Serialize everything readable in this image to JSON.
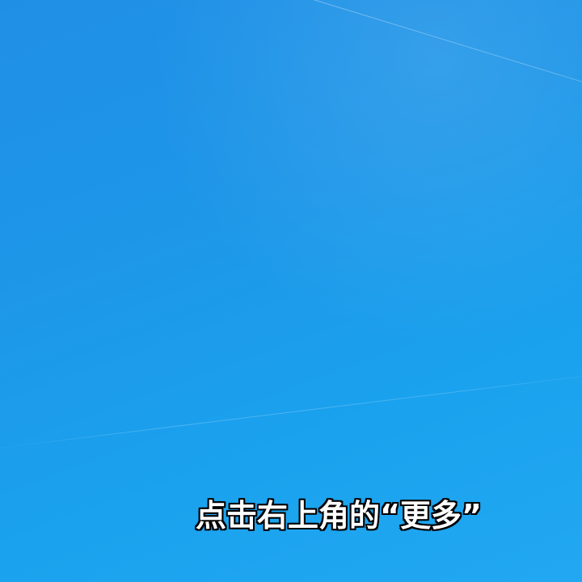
{
  "screen": {
    "background_color": "#1e96e8",
    "caption_text": "点击右上角的“更多”"
  }
}
